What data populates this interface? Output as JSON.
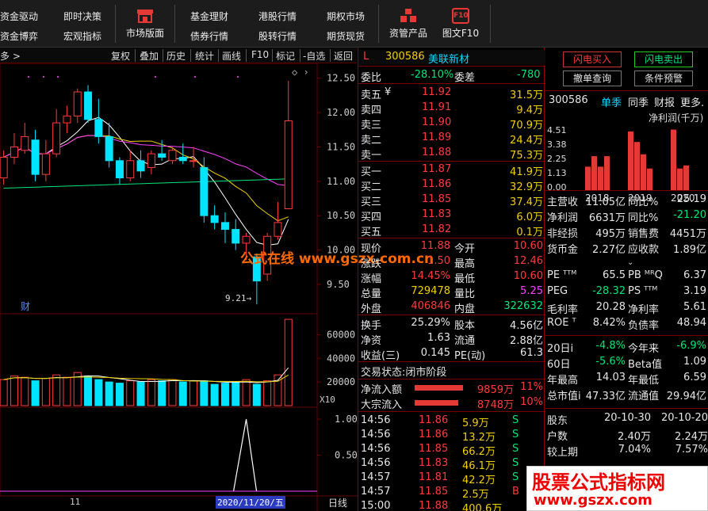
{
  "menu": {
    "row1": [
      "资金驱动",
      "即时决策",
      "基金理财",
      "港股行情",
      "期权市场"
    ],
    "row2": [
      "资金博弈",
      "宏观指标",
      "债券行情",
      "股转行情",
      "期货现货"
    ],
    "big": [
      "市场版面",
      "资管产品",
      "图文F10"
    ],
    "f10_icon_text": "F10"
  },
  "chart_toolbar": {
    "left": "多 >",
    "buttons": [
      "复权",
      "叠加",
      "历史",
      "统计",
      "画线",
      "F10",
      "标记",
      "-自选",
      "返回"
    ]
  },
  "price_axis": [
    "12.50",
    "12.00",
    "11.50",
    "11.00",
    "10.50",
    "10.00",
    "9.50"
  ],
  "volume_axis": [
    "60000",
    "40000",
    "20000"
  ],
  "volume_multiplier": "X10",
  "indicator_axis": [
    "1.00",
    "0.50"
  ],
  "low_marker": "9.21",
  "event_marker": "财",
  "date_label": "2020/11/20/五",
  "month_label": "11",
  "period_label": "日线",
  "watermark_center": "公式在线  www.gszx.com.cn",
  "watermark_corner": {
    "line1": "股票公式指标网",
    "line2": "www.gszx.com"
  },
  "quote": {
    "flag": "L",
    "code": "300586",
    "name": "美联新材",
    "weibi_label": "委比",
    "weibi": "-28.10%",
    "weicha_label": "委差",
    "weicha": "-780",
    "asks": [
      {
        "label": "卖五",
        "price": "11.92",
        "vol": "31.5万"
      },
      {
        "label": "卖四",
        "price": "11.91",
        "vol": "9.4万"
      },
      {
        "label": "卖三",
        "price": "11.90",
        "vol": "70.9万"
      },
      {
        "label": "卖二",
        "price": "11.89",
        "vol": "24.4万"
      },
      {
        "label": "卖一",
        "price": "11.88",
        "vol": "75.3万"
      }
    ],
    "ask_currency": "¥",
    "bids": [
      {
        "label": "买一",
        "price": "11.87",
        "vol": "41.9万"
      },
      {
        "label": "买二",
        "price": "11.86",
        "vol": "32.9万"
      },
      {
        "label": "买三",
        "price": "11.85",
        "vol": "37.4万"
      },
      {
        "label": "买四",
        "price": "11.83",
        "vol": "6.0万"
      },
      {
        "label": "买五",
        "price": "11.82",
        "vol": "0.1万"
      }
    ],
    "stats": [
      {
        "l1": "现价",
        "v1": "11.88",
        "l2": "今开",
        "v2": "10.60"
      },
      {
        "l1": "涨跌",
        "v1": "1.50",
        "l2": "最高",
        "v2": "12.46"
      },
      {
        "l1": "涨幅",
        "v1": "14.45%",
        "l2": "最低",
        "v2": "10.60"
      },
      {
        "l1": "总量",
        "v1": "729478",
        "l2": "量比",
        "v2": "5.25"
      },
      {
        "l1": "外盘",
        "v1": "406846",
        "l2": "内盘",
        "v2": "322632"
      }
    ],
    "stats2": [
      {
        "l1": "换手",
        "v1": "25.29%",
        "l2": "股本",
        "v2": "4.56亿"
      },
      {
        "l1": "净资",
        "v1": "1.63",
        "l2": "流通",
        "v2": "2.88亿"
      },
      {
        "l1": "收益(三)",
        "v1": "0.145",
        "l2": "PE(动)",
        "v2": "61.3"
      }
    ],
    "trade_status": "交易状态:闭市阶段",
    "flows": [
      {
        "label": "净流入额",
        "value": "9859万",
        "pct": "11%",
        "fill": 0.55
      },
      {
        "label": "大宗流入",
        "value": "8748万",
        "pct": "10%",
        "fill": 0.5
      }
    ],
    "ticks": [
      {
        "t": "14:56",
        "p": "11.86",
        "v": "5.9万",
        "f": "S"
      },
      {
        "t": "14:56",
        "p": "11.86",
        "v": "13.2万",
        "f": "S"
      },
      {
        "t": "14:56",
        "p": "11.85",
        "v": "66.2万",
        "f": "S"
      },
      {
        "t": "14:56",
        "p": "11.83",
        "v": "46.1万",
        "f": "S"
      },
      {
        "t": "14:57",
        "p": "11.81",
        "v": "42.2万",
        "f": "S"
      },
      {
        "t": "14:57",
        "p": "11.85",
        "v": "2.5万",
        "f": "B"
      },
      {
        "t": "15:00",
        "p": "11.88",
        "v": "400.6万",
        "f": ""
      }
    ]
  },
  "far": {
    "buttons": [
      "闪电买入",
      "闪电卖出",
      "撤单查询",
      "条件预警"
    ],
    "tabs": [
      "300586",
      "单季",
      "同季",
      "财报",
      "更多."
    ],
    "chart_title": "净利润(千万)",
    "chart_yaxis": [
      "4.51",
      "3.38",
      "2.25",
      "1.13",
      "0.00"
    ],
    "chart_xaxis": [
      "2018",
      "2019",
      "2020"
    ],
    "fin_rows": [
      {
        "a": "主营收",
        "b": "11.05亿",
        "c": "同比%",
        "d": "25.19"
      },
      {
        "a": "净利润",
        "b": "6631万",
        "c": "同比%",
        "d": "-21.20"
      },
      {
        "a": "非经损",
        "b": "495万",
        "c": "销售费",
        "d": "4451万"
      },
      {
        "a": "货币金",
        "b": "2.27亿",
        "c": "应收款",
        "d": "1.89亿"
      }
    ],
    "val_rows": [
      {
        "a": "PE ᵀᵀᴹ",
        "b": "65.5",
        "c": "PB ᴹᴿQ",
        "d": "6.37"
      },
      {
        "a": "PEG",
        "b": "-28.32",
        "c": "PS ᵀᵀᴹ",
        "d": "3.19"
      },
      {
        "a": "毛利率",
        "b": "20.28",
        "c": "净利率",
        "d": "5.61"
      },
      {
        "a": "ROE ᵀ",
        "b": "8.42%",
        "c": "负债率",
        "d": "48.94"
      }
    ],
    "perf_rows": [
      {
        "a": "20日i",
        "b": "-4.8%",
        "c": "今年来",
        "d": "-6.9%"
      },
      {
        "a": "60日",
        "b": "-5.6%",
        "c": "Beta值",
        "d": "1.09"
      },
      {
        "a": "年最高",
        "b": "14.03",
        "c": "年最低",
        "d": "6.59"
      },
      {
        "a": "总市值i",
        "b": "47.33亿",
        "c": "流通值",
        "d": "29.94亿"
      }
    ],
    "holder_rows": [
      {
        "a": "股东",
        "b": "20-10-30",
        "c": "20-10-20"
      },
      {
        "a": "户数",
        "b": "2.40万",
        "c": "2.24万"
      },
      {
        "a": "较上期",
        "b": "7.04%",
        "c": "7.57%"
      }
    ]
  },
  "chart_data": {
    "type": "candlestick",
    "price_range": [
      9.2,
      12.6
    ],
    "candles": [
      {
        "o": 11.05,
        "h": 11.45,
        "l": 10.95,
        "c": 11.35
      },
      {
        "o": 11.35,
        "h": 11.7,
        "l": 11.25,
        "c": 11.5
      },
      {
        "o": 11.45,
        "h": 11.85,
        "l": 11.4,
        "c": 11.65
      },
      {
        "o": 11.6,
        "h": 11.75,
        "l": 11.0,
        "c": 11.1
      },
      {
        "o": 11.1,
        "h": 11.6,
        "l": 11.0,
        "c": 11.4
      },
      {
        "o": 11.4,
        "h": 12.05,
        "l": 11.35,
        "c": 11.85
      },
      {
        "o": 11.85,
        "h": 12.1,
        "l": 11.7,
        "c": 11.95
      },
      {
        "o": 11.95,
        "h": 12.35,
        "l": 11.85,
        "c": 12.3
      },
      {
        "o": 12.3,
        "h": 12.4,
        "l": 11.85,
        "c": 11.9
      },
      {
        "o": 11.9,
        "h": 12.2,
        "l": 11.55,
        "c": 11.65
      },
      {
        "o": 11.65,
        "h": 11.85,
        "l": 11.2,
        "c": 11.3
      },
      {
        "o": 11.3,
        "h": 11.35,
        "l": 10.95,
        "c": 11.05
      },
      {
        "o": 11.05,
        "h": 11.45,
        "l": 11.0,
        "c": 11.3
      },
      {
        "o": 11.3,
        "h": 11.45,
        "l": 11.05,
        "c": 11.15
      },
      {
        "o": 11.2,
        "h": 11.45,
        "l": 11.1,
        "c": 11.4
      },
      {
        "o": 11.4,
        "h": 11.6,
        "l": 11.3,
        "c": 11.35
      },
      {
        "o": 11.3,
        "h": 11.5,
        "l": 11.25,
        "c": 11.45
      },
      {
        "o": 11.35,
        "h": 11.55,
        "l": 11.25,
        "c": 11.3
      },
      {
        "o": 11.3,
        "h": 11.5,
        "l": 11.2,
        "c": 11.3
      },
      {
        "o": 11.2,
        "h": 11.35,
        "l": 10.4,
        "c": 10.5
      },
      {
        "o": 10.5,
        "h": 10.65,
        "l": 10.3,
        "c": 10.4
      },
      {
        "o": 10.4,
        "h": 10.55,
        "l": 10.1,
        "c": 10.3
      },
      {
        "o": 10.3,
        "h": 10.45,
        "l": 10.0,
        "c": 10.1
      },
      {
        "o": 10.1,
        "h": 10.25,
        "l": 9.85,
        "c": 10.2
      },
      {
        "o": 9.9,
        "h": 9.95,
        "l": 9.21,
        "c": 9.55
      },
      {
        "o": 9.65,
        "h": 10.25,
        "l": 9.55,
        "c": 10.2
      },
      {
        "o": 10.2,
        "h": 10.7,
        "l": 10.15,
        "c": 10.4
      },
      {
        "o": 10.6,
        "h": 12.46,
        "l": 10.6,
        "c": 11.88
      }
    ],
    "volumes": [
      22000,
      25000,
      24000,
      21000,
      23000,
      26000,
      24000,
      28000,
      25000,
      22000,
      20000,
      19000,
      21000,
      20000,
      22000,
      21000,
      22000,
      20000,
      21000,
      21000,
      18000,
      19000,
      20000,
      22000,
      18000,
      21000,
      26000,
      72948
    ]
  }
}
